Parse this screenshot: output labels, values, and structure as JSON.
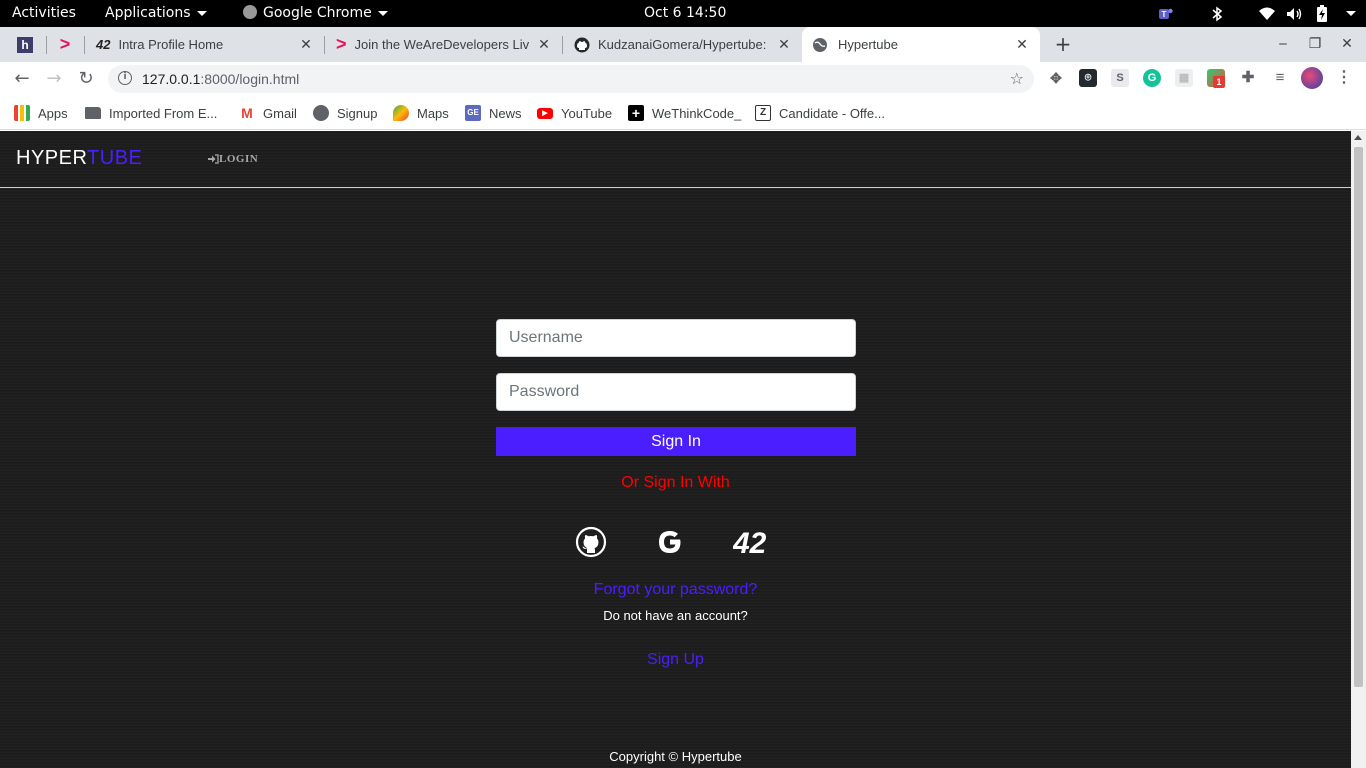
{
  "system": {
    "activities": "Activities",
    "applications": "Applications",
    "app_name": "Google Chrome",
    "datetime": "Oct 6  14:50"
  },
  "tabs": [
    {
      "title": "Intra Profile Home"
    },
    {
      "title": "Join the WeAreDevelopers Liv"
    },
    {
      "title": "KudzanaiGomera/Hypertube:"
    },
    {
      "title": "Hypertube",
      "active": true
    }
  ],
  "toolbar": {
    "url_host": "127.0.0.1",
    "url_path": ":8000/login.html"
  },
  "bookmarks": [
    {
      "label": "Apps",
      "icon": "apps-grid-icon"
    },
    {
      "label": "Imported From E...",
      "icon": "folder-icon"
    },
    {
      "label": "Gmail",
      "icon": "gmail-icon"
    },
    {
      "label": "Signup",
      "icon": "globe-icon"
    },
    {
      "label": "Maps",
      "icon": "maps-icon"
    },
    {
      "label": "News",
      "icon": "news-icon"
    },
    {
      "label": "YouTube",
      "icon": "youtube-icon"
    },
    {
      "label": "WeThinkCode_",
      "icon": "wethinkcode-icon"
    },
    {
      "label": "Candidate - Offe...",
      "icon": "zendesk-icon"
    }
  ],
  "extensions": {
    "badge_count": "1"
  },
  "site": {
    "logo_part1": "HYPER",
    "logo_part2": "TUBE",
    "nav_login": "LOGIN",
    "username_placeholder": "Username",
    "password_placeholder": "Password",
    "signin_label": "Sign In",
    "or_text": "Or Sign In With",
    "oauth": [
      "github-icon",
      "google-icon",
      "42-icon"
    ],
    "oauth_42_label": "42",
    "forgot_label": "Forgot your password?",
    "no_account_text": "Do not have an account?",
    "signup_label": "Sign Up",
    "copyright": "Copyright © Hypertube"
  },
  "colors": {
    "accent": "#4a1eff",
    "or_text": "#ff0000",
    "page_bg": "#1c1c1c"
  }
}
